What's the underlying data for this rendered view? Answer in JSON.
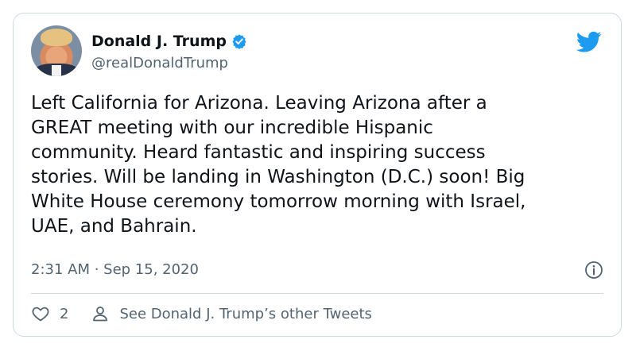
{
  "tweet": {
    "author_name": "Donald J. Trump",
    "handle": "@realDonaldTrump",
    "text": "Left California for Arizona. Leaving Arizona after a\nGREAT meeting with our incredible Hispanic\ncommunity. Heard fantastic and inspiring success\nstories. Will be landing in Washington (D.C.) soon! Big\nWhite House ceremony tomorrow morning with Israel,\nUAE, and Bahrain.",
    "timestamp": "2:31 AM · Sep 15, 2020",
    "like_count": "2",
    "see_other_label": "See Donald J. Trump’s other Tweets"
  },
  "icons": {
    "verified": "verified-badge-icon",
    "brand": "twitter-bird-icon",
    "info": "info-icon",
    "like": "heart-icon",
    "profile": "person-icon"
  },
  "colors": {
    "brand": "#1d9bf0",
    "text": "#0f1419",
    "secondary": "#536471",
    "border": "#cfd9de"
  }
}
